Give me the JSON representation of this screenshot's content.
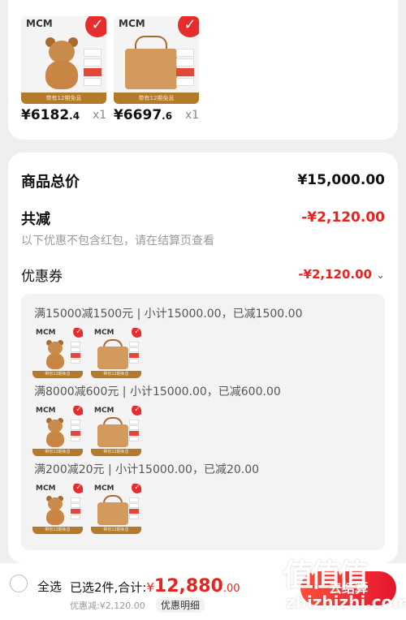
{
  "top_items": [
    {
      "brand": "MCM",
      "strip": "带有12期免息",
      "price_main": "¥6182",
      "price_dec": ".4",
      "qty": "x1",
      "kind": "bear"
    },
    {
      "brand": "MCM",
      "strip": "带有12期免息",
      "price_main": "¥6697",
      "price_dec": ".6",
      "qty": "x1",
      "kind": "bag"
    }
  ],
  "badge_icon": "check-icon",
  "summary": {
    "total_label": "商品总价",
    "total_value": "¥15,000.00",
    "reduce_label": "共减",
    "reduce_value": "-¥2,120.00",
    "note": "以下优惠不包含红包，请在结算页查看",
    "coupon_label": "优惠券",
    "coupon_value": "-¥2,120.00",
    "coupon_chevron": "chevron-down-icon"
  },
  "coupon_groups": [
    {
      "title": "满15000减1500元 | 小计15000.00，已减1500.00"
    },
    {
      "title": "满8000减600元 | 小计15000.00，已减600.00"
    },
    {
      "title": "满200减20元 | 小计15000.00，已减20.00"
    }
  ],
  "bottom": {
    "select_all": "全选",
    "selected": "已选2件,合计:",
    "currency": "¥",
    "total_main": "12,880",
    "total_dec": ".00",
    "discount": "优惠减:¥2,120.00",
    "detail": "优惠明细",
    "checkout": "去结算"
  },
  "watermark": {
    "glyphs": "值值值",
    "url": "zhizhizhi.com"
  },
  "colors": {
    "accent": "#e6231f",
    "strip": "#b47a2c",
    "background": "#efefef"
  }
}
